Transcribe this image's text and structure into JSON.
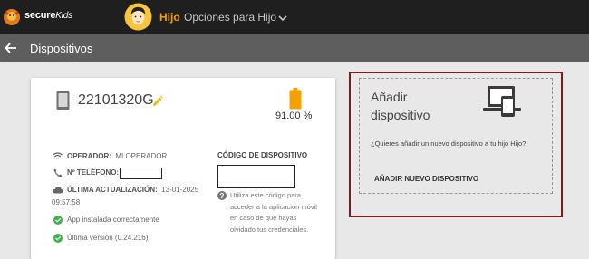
{
  "header": {
    "brand_main": "secure",
    "brand_accent": "Kids",
    "child_name": "Hijo",
    "child_menu_label": "Opciones para Hijo"
  },
  "subheader": {
    "title": "Dispositivos"
  },
  "device": {
    "name": "22101320G",
    "battery_label": "91.00 %",
    "battery_level": 0.91,
    "operator_label": "OPERADOR:",
    "operator_value": "MI OPERADOR",
    "phone_label": "Nº TELÉFONO:",
    "last_update_label": "ÚLTIMA ACTUALIZACIÓN:",
    "last_update_date": "13-01-2025",
    "last_update_time": "09:57:58",
    "status_installed": "App instalada correctamente",
    "status_version": "Última versión (0.24.216)",
    "code_label": "CÓDIGO DE DISPOSITIVO",
    "code_desc": "Utiliza este código para acceder a la aplicación móvil en caso de que hayas olvidado tus credenciales."
  },
  "add_device": {
    "title": "Añadir dispositivo",
    "description": "¿Quieres añadir un nuevo dispositivo a tu hijo Hijo?",
    "button_label": "AÑADIR NUEVO DISPOSITIVO"
  },
  "colors": {
    "topbar": "#1f1f1f",
    "subbar": "#5e5e5e",
    "accent_orange": "#f2a100",
    "battery": "#f5a000",
    "success_green": "#43b14b",
    "panel_border": "#7d1a1a"
  },
  "icons": [
    "logo-icon",
    "avatar-icon",
    "chevron-down-icon",
    "back-arrow-icon",
    "phone-icon",
    "edit-pencil-icon",
    "battery-icon",
    "wifi-icon",
    "phone-call-icon",
    "cloud-sync-icon",
    "check-circle-icon",
    "help-circle-icon",
    "devices-icon"
  ]
}
